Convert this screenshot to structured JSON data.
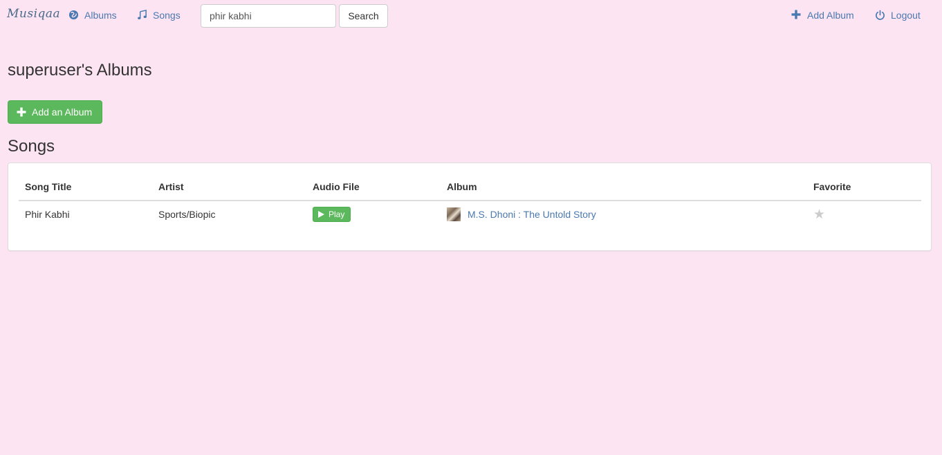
{
  "navbar": {
    "brand": "Musiqaa",
    "albums_label": "Albums",
    "songs_label": "Songs",
    "search_value": "phir kabhi",
    "search_button": "Search",
    "add_album_label": "Add Album",
    "logout_label": "Logout"
  },
  "page": {
    "title": "superuser's Albums",
    "add_album_button": "Add an Album",
    "songs_heading": "Songs"
  },
  "table": {
    "headers": [
      "Song Title",
      "Artist",
      "Audio File",
      "Album",
      "Favorite"
    ],
    "rows": [
      {
        "title": "Phir Kabhi",
        "artist": "Sports/Biopic",
        "audio_button": "Play",
        "album": "M.S. Dhoni : The Untold Story",
        "favorite": false
      }
    ]
  },
  "icons": {
    "albums": "globe-icon",
    "songs": "music-note-icon",
    "add": "plus-icon",
    "logout": "power-icon",
    "play": "play-icon",
    "favorite": "star-icon"
  },
  "colors": {
    "background": "#fde4f2",
    "link": "#4a78b0",
    "success": "#5cb85c"
  }
}
